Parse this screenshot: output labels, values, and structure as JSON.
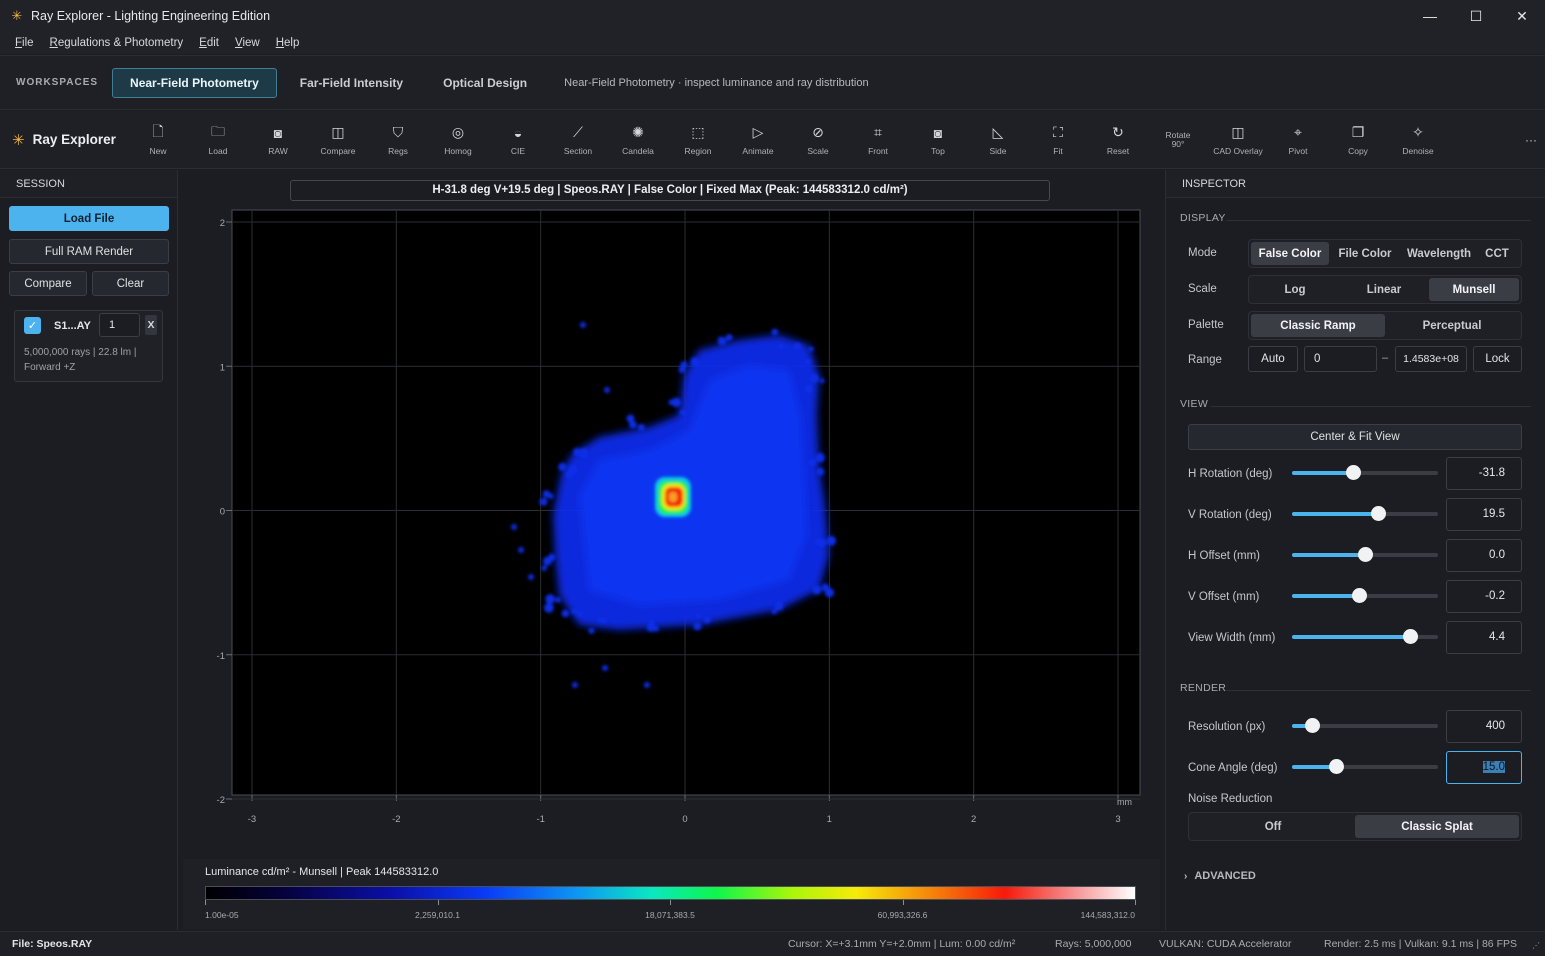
{
  "window": {
    "title": "Ray Explorer - Lighting Engineering Edition"
  },
  "menu": [
    {
      "pre": "",
      "u": "F",
      "post": "ile"
    },
    {
      "pre": "",
      "u": "R",
      "post": "egulations & Photometry"
    },
    {
      "pre": "",
      "u": "E",
      "post": "dit"
    },
    {
      "pre": "",
      "u": "V",
      "post": "iew"
    },
    {
      "pre": "",
      "u": "H",
      "post": "elp"
    }
  ],
  "workspaces": {
    "label": "WORKSPACES",
    "tabs": [
      "Near-Field Photometry",
      "Far-Field Intensity",
      "Optical Design"
    ],
    "active": 0,
    "description": "Near-Field Photometry · inspect luminance and ray distribution"
  },
  "toolbar": {
    "brand": "Ray Explorer",
    "tools": [
      {
        "label": "New",
        "icon": "new-file-icon",
        "glyph": "🗋"
      },
      {
        "label": "Load",
        "icon": "folder-icon",
        "glyph": "🗀"
      },
      {
        "label": "RAW",
        "icon": "camera-icon",
        "glyph": "◙"
      },
      {
        "label": "Compare",
        "icon": "compare-icon",
        "glyph": "◫"
      },
      {
        "label": "Regs",
        "icon": "shield-icon",
        "glyph": "⛉"
      },
      {
        "label": "Homog",
        "icon": "target-icon",
        "glyph": "◎"
      },
      {
        "label": "CIE",
        "icon": "cie-icon",
        "glyph": "◒"
      },
      {
        "label": "Section",
        "icon": "section-icon",
        "glyph": "⟋"
      },
      {
        "label": "Candela",
        "icon": "sun-icon",
        "glyph": "✺"
      },
      {
        "label": "Region",
        "icon": "region-icon",
        "glyph": "⬚"
      },
      {
        "label": "Animate",
        "icon": "play-icon",
        "glyph": "▷"
      },
      {
        "label": "Scale",
        "icon": "ruler-icon",
        "glyph": "⊘"
      },
      {
        "label": "Front",
        "icon": "front-view-icon",
        "glyph": "⌗"
      },
      {
        "label": "Top",
        "icon": "top-view-icon",
        "glyph": "◙"
      },
      {
        "label": "Side",
        "icon": "side-view-icon",
        "glyph": "◺"
      },
      {
        "label": "Fit",
        "icon": "fit-icon",
        "glyph": "⛶"
      },
      {
        "label": "Reset",
        "icon": "reset-icon",
        "glyph": "↻"
      },
      {
        "label": "Rotate\n90°",
        "icon": "rotate-icon",
        "glyph": ""
      },
      {
        "label": "CAD Overlay",
        "icon": "cad-overlay-icon",
        "glyph": "◫"
      },
      {
        "label": "Pivot",
        "icon": "pivot-icon",
        "glyph": "⌖"
      },
      {
        "label": "Copy",
        "icon": "copy-icon",
        "glyph": "❐"
      },
      {
        "label": "Denoise",
        "icon": "sparkle-icon",
        "glyph": "✧"
      }
    ],
    "more": "···"
  },
  "session": {
    "header": "SESSION",
    "load_file": "Load File",
    "full_ram": "Full RAM Render",
    "compare": "Compare",
    "clear": "Clear",
    "file": {
      "name": "S1...AY",
      "number": "1",
      "remove": "X",
      "info": "5,000,000 rays | 22.8 lm | Forward +Z"
    }
  },
  "view": {
    "header": "H-31.8 deg V+19.5 deg  |  Speos.RAY | False Color | Fixed Max (Peak: 144583312.0 cd/m²)",
    "unit": "mm"
  },
  "chart_data": {
    "type": "heatmap",
    "x_ticks": [
      "-3",
      "-2",
      "-1",
      "0",
      "1",
      "2",
      "3"
    ],
    "y_ticks": [
      "2",
      "1",
      "0",
      "-1",
      "-2"
    ],
    "xlim": [
      -3,
      3
    ],
    "ylim": [
      -2,
      2
    ],
    "xlabel": "mm",
    "grid": true
  },
  "colorbar": {
    "title": "Luminance cd/m² - Munsell | Peak 144583312.0",
    "labels": [
      "1.00e-05",
      "2,259,010.1",
      "18,071,383.5",
      "60,993,326.6",
      "144,583,312.0"
    ]
  },
  "inspector": {
    "header": "INSPECTOR",
    "display": {
      "section": "DISPLAY",
      "mode_label": "Mode",
      "modes": [
        "False Color",
        "File Color",
        "Wavelength",
        "CCT"
      ],
      "mode_active": 0,
      "scale_label": "Scale",
      "scales": [
        "Log",
        "Linear",
        "Munsell"
      ],
      "scale_active": 2,
      "palette_label": "Palette",
      "palettes": [
        "Classic Ramp",
        "Perceptual"
      ],
      "palette_active": 0,
      "range_label": "Range",
      "range_auto": "Auto",
      "range_min": "0",
      "range_dash": "–",
      "range_max": "1.4583e+08",
      "range_lock": "Lock"
    },
    "view": {
      "section": "VIEW",
      "center_fit": "Center & Fit View",
      "sliders": [
        {
          "label": "H Rotation (deg)",
          "value": "-31.8",
          "pos": 0.42
        },
        {
          "label": "V Rotation (deg)",
          "value": "19.5",
          "pos": 0.59
        },
        {
          "label": "H Offset (mm)",
          "value": "0.0",
          "pos": 0.5
        },
        {
          "label": "V Offset (mm)",
          "value": "-0.2",
          "pos": 0.46
        },
        {
          "label": "View Width (mm)",
          "value": "4.4",
          "pos": 0.81
        }
      ]
    },
    "render": {
      "section": "RENDER",
      "resolution_label": "Resolution (px)",
      "resolution": "400",
      "resolution_pos": 0.14,
      "cone_label": "Cone Angle (deg)",
      "cone": "15.0",
      "cone_pos": 0.3,
      "noise_label": "Noise Reduction",
      "noise_options": [
        "Off",
        "Classic Splat"
      ],
      "noise_active": 1
    },
    "advanced": "ADVANCED"
  },
  "status": {
    "file": "File: Speos.RAY",
    "cursor": "Cursor: X=+3.1mm Y=+2.0mm  |  Lum: 0.00 cd/m²",
    "rays": "Rays: 5,000,000",
    "backend": "VULKAN: CUDA Accelerator",
    "render": "Render: 2.5 ms | Vulkan: 9.1 ms | 86 FPS"
  }
}
